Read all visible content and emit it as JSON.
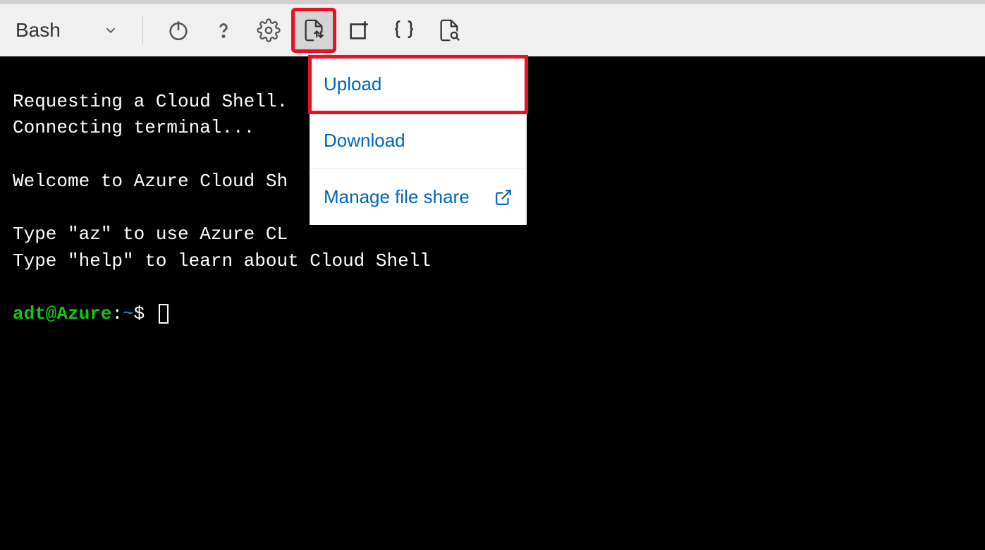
{
  "toolbar": {
    "shell_label": "Bash",
    "icons": {
      "power": "power-icon",
      "help": "help-icon",
      "settings": "gear-icon",
      "file_transfer": "file-transfer-icon",
      "new_session": "new-session-icon",
      "editor": "braces-icon",
      "preview": "file-search-icon"
    }
  },
  "dropdown": {
    "items": [
      {
        "label": "Upload"
      },
      {
        "label": "Download"
      },
      {
        "label": "Manage file share",
        "external": true
      }
    ]
  },
  "terminal": {
    "lines": [
      "Requesting a Cloud Shell.",
      "Connecting terminal...",
      "",
      "Welcome to Azure Cloud Sh",
      "",
      "Type \"az\" to use Azure CL",
      "Type \"help\" to learn about Cloud Shell"
    ],
    "prompt": {
      "user_host": "adt@Azure",
      "separator": ":",
      "path": "~",
      "symbol": "$"
    }
  }
}
